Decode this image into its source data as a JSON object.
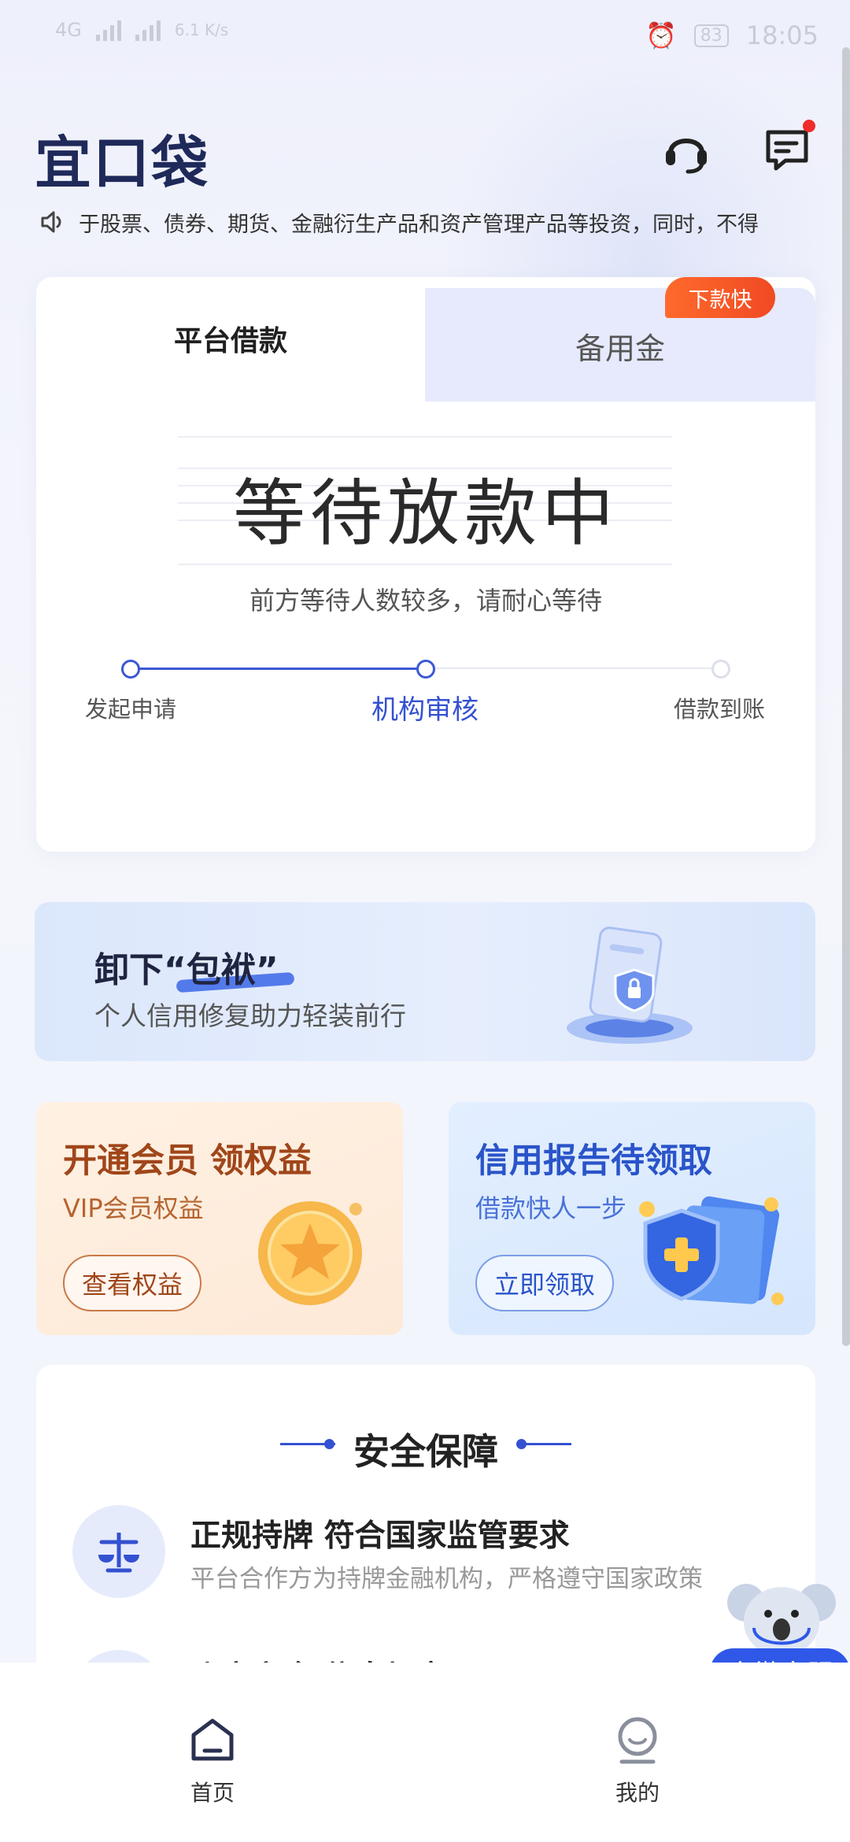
{
  "status_bar": {
    "network": "4G",
    "speed": "6.1 K/s",
    "battery": "83",
    "time": "18:05"
  },
  "header": {
    "logo": "宜口袋",
    "support_icon": "headset-icon",
    "message_icon": "message-icon"
  },
  "notice": {
    "icon": "speaker-icon",
    "text": "于股票、债券、期货、金融衍生产品和资产管理产品等投资，同时，不得"
  },
  "loan_card": {
    "tabs": [
      {
        "label": "平台借款",
        "active": true
      },
      {
        "label": "备用金",
        "active": false
      }
    ],
    "badge": "下款快",
    "status_title": "等待放款中",
    "status_sub": "前方等待人数较多，请耐心等待",
    "steps": [
      {
        "label": "发起申请",
        "state": "done"
      },
      {
        "label": "机构审核",
        "state": "active"
      },
      {
        "label": "借款到账",
        "state": "pending"
      }
    ]
  },
  "banner": {
    "title_prefix": "卸下",
    "title_highlight": "“包袱”",
    "subtitle": "个人信用修复助力轻装前行"
  },
  "promos": [
    {
      "title": "开通会员 领权益",
      "sub": "VIP会员权益",
      "button": "查看权益"
    },
    {
      "title": "信用报告待领取",
      "sub": "借款快人一步",
      "button": "立即领取"
    }
  ],
  "safety": {
    "title": "安全保障",
    "items": [
      {
        "icon": "balance-scale-icon",
        "heading": "正规持牌 符合国家监管要求",
        "desc": "平台合作方为持牌金融机构，严格遵守国家政策"
      },
      {
        "icon": "id-card-icon",
        "heading": "账户安全 信息加密",
        "desc": ""
      }
    ]
  },
  "float_service": {
    "label": "企微客服"
  },
  "bottom_nav": [
    {
      "label": "首页",
      "icon": "home-icon",
      "active": true
    },
    {
      "label": "我的",
      "icon": "profile-icon",
      "active": false
    }
  ],
  "colors": {
    "primary": "#3451d1",
    "badge": "#f04a23",
    "vip_text": "#a0461a",
    "credit_text": "#2a54c9"
  }
}
